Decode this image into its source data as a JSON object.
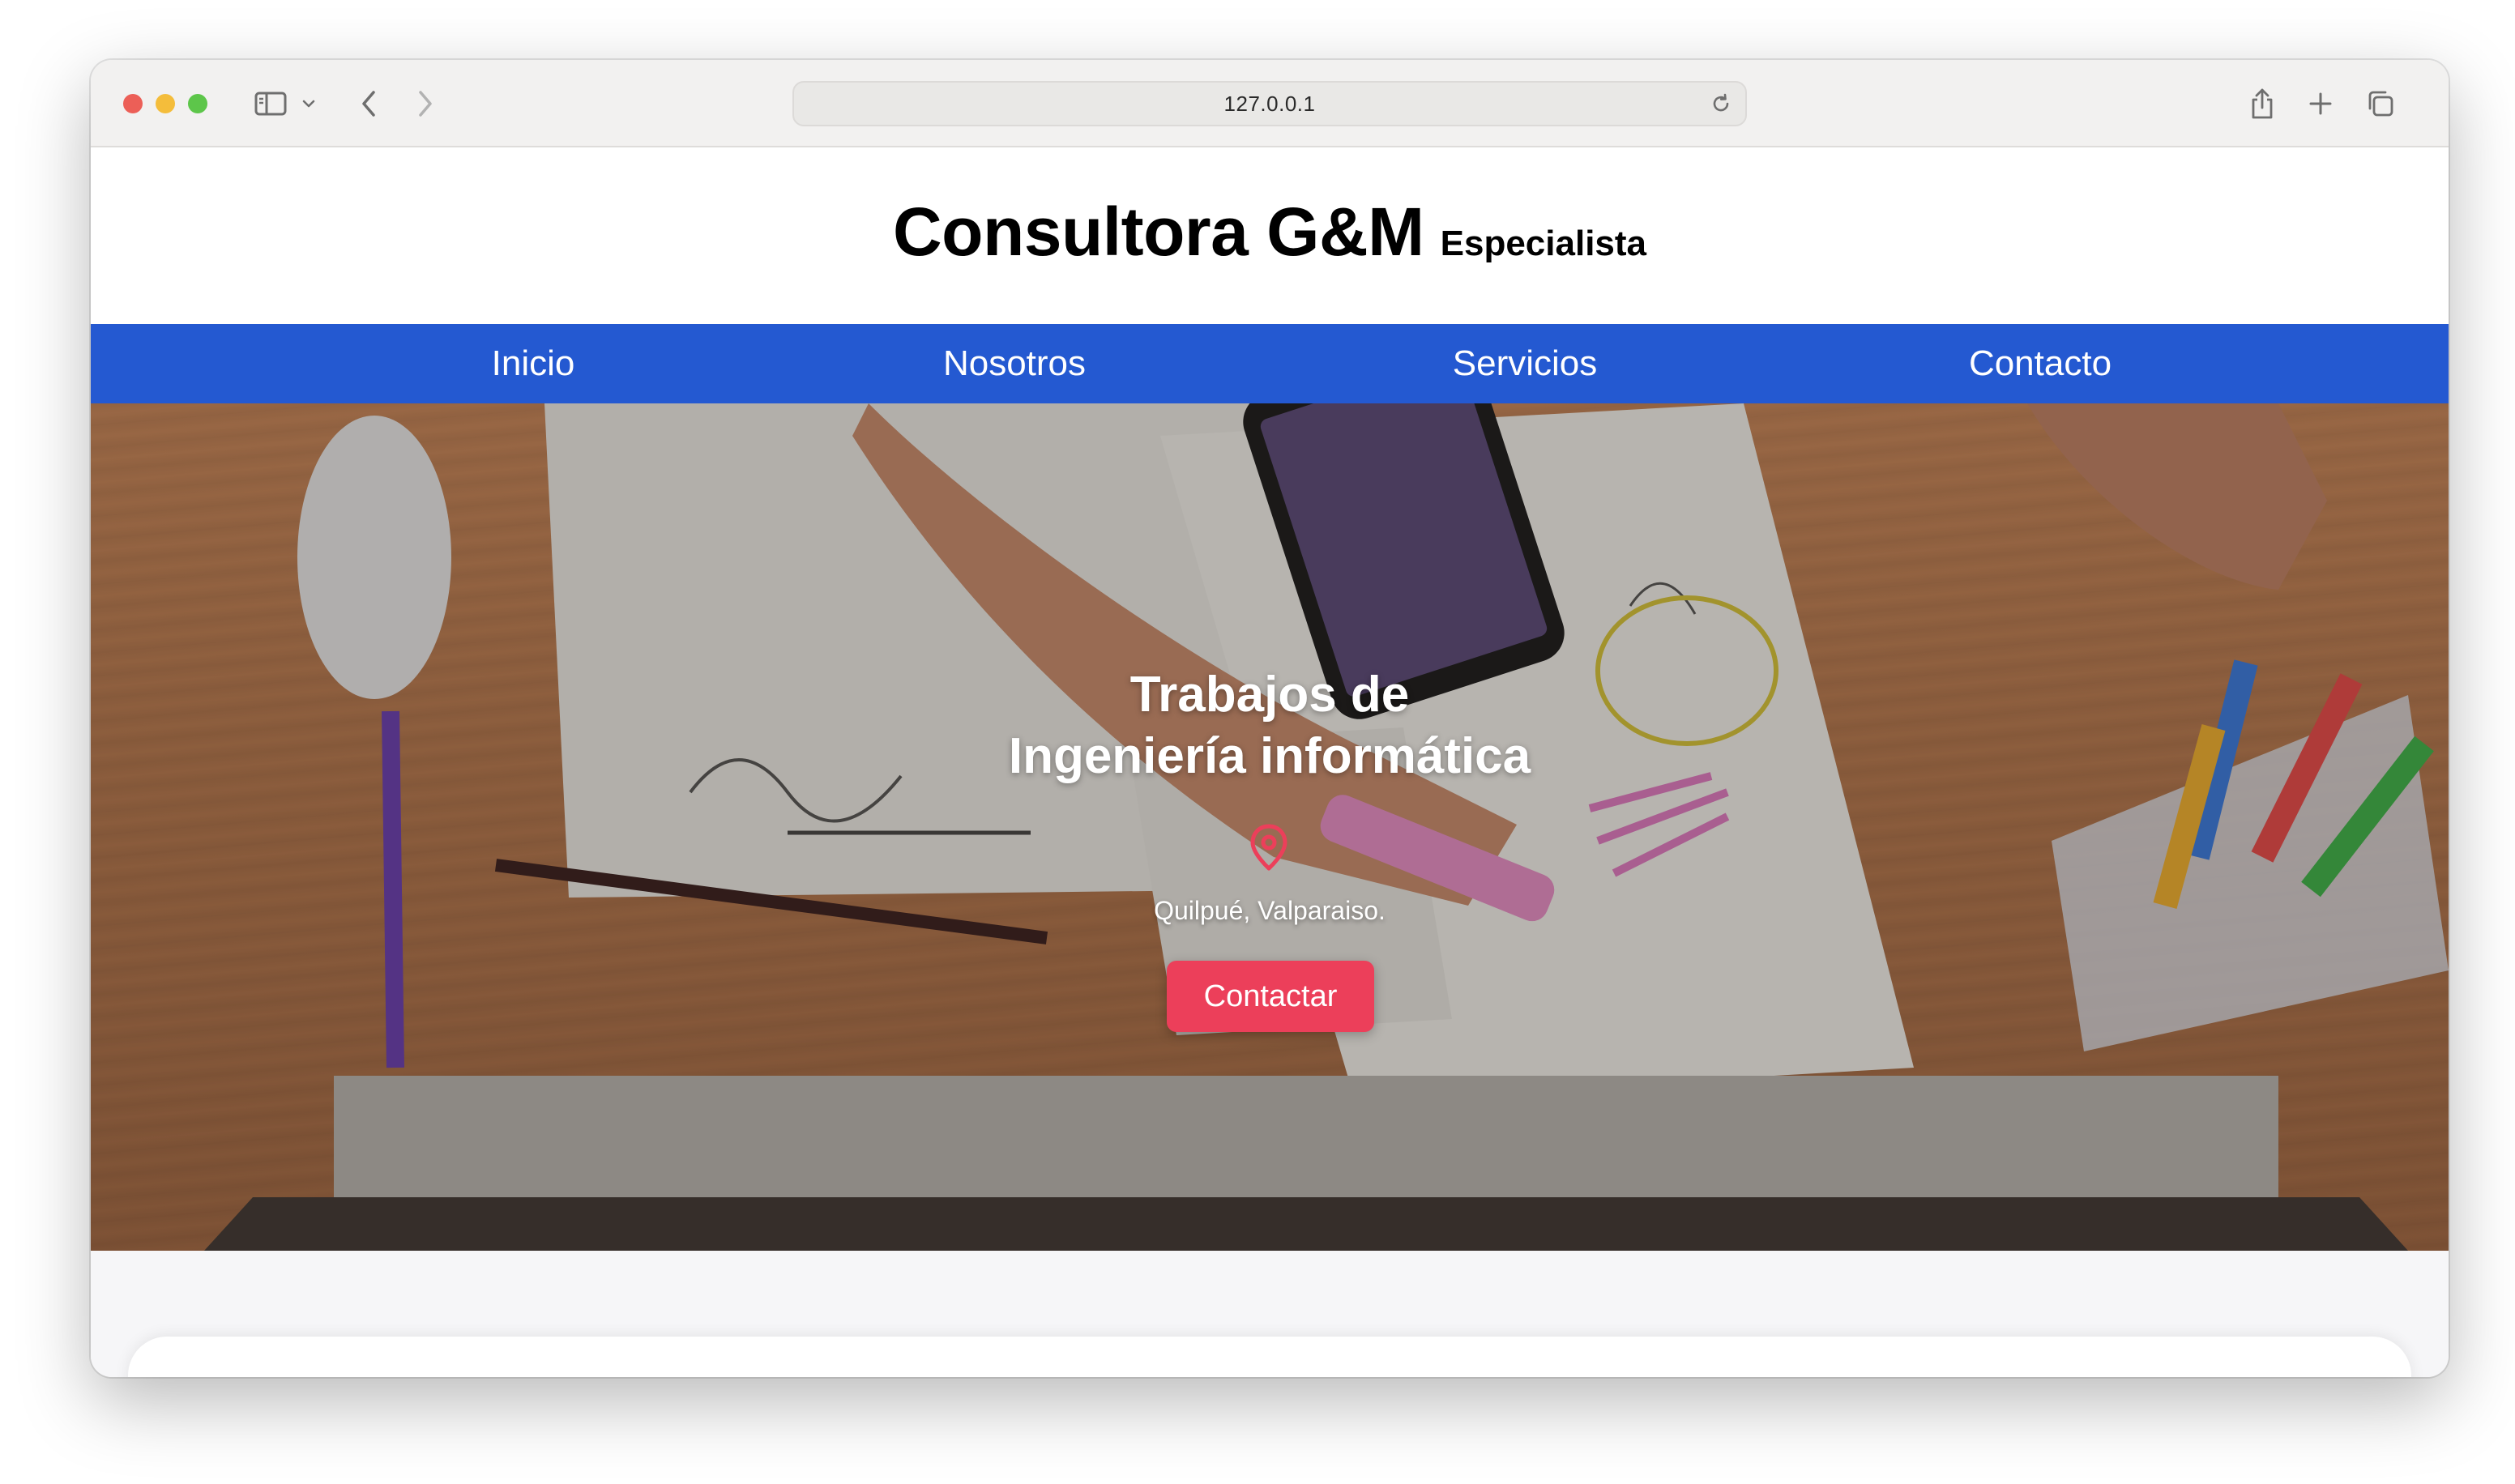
{
  "browser": {
    "url": "127.0.0.1",
    "icons": {
      "sidebar": "sidebar-icon",
      "sidebar_menu": "chevron-down-icon",
      "back": "chevron-left-icon",
      "forward": "chevron-right-icon",
      "reload": "reload-icon",
      "share": "share-icon",
      "new_tab": "plus-icon",
      "tabs": "tabs-icon"
    }
  },
  "header": {
    "brand_name": "Consultora G&M",
    "brand_tag": "Especialista"
  },
  "nav": {
    "items": [
      {
        "label": "Inicio"
      },
      {
        "label": "Nosotros"
      },
      {
        "label": "Servicios"
      },
      {
        "label": "Contacto"
      }
    ],
    "color": "#2459d1"
  },
  "hero": {
    "title_line1": "Trabajos de",
    "title_line2": "Ingeniería informática",
    "pin_icon": "location-pin-icon",
    "location": "Quilpué, Valparaiso.",
    "cta_label": "Contactar",
    "cta_color": "#ec3f5a"
  }
}
